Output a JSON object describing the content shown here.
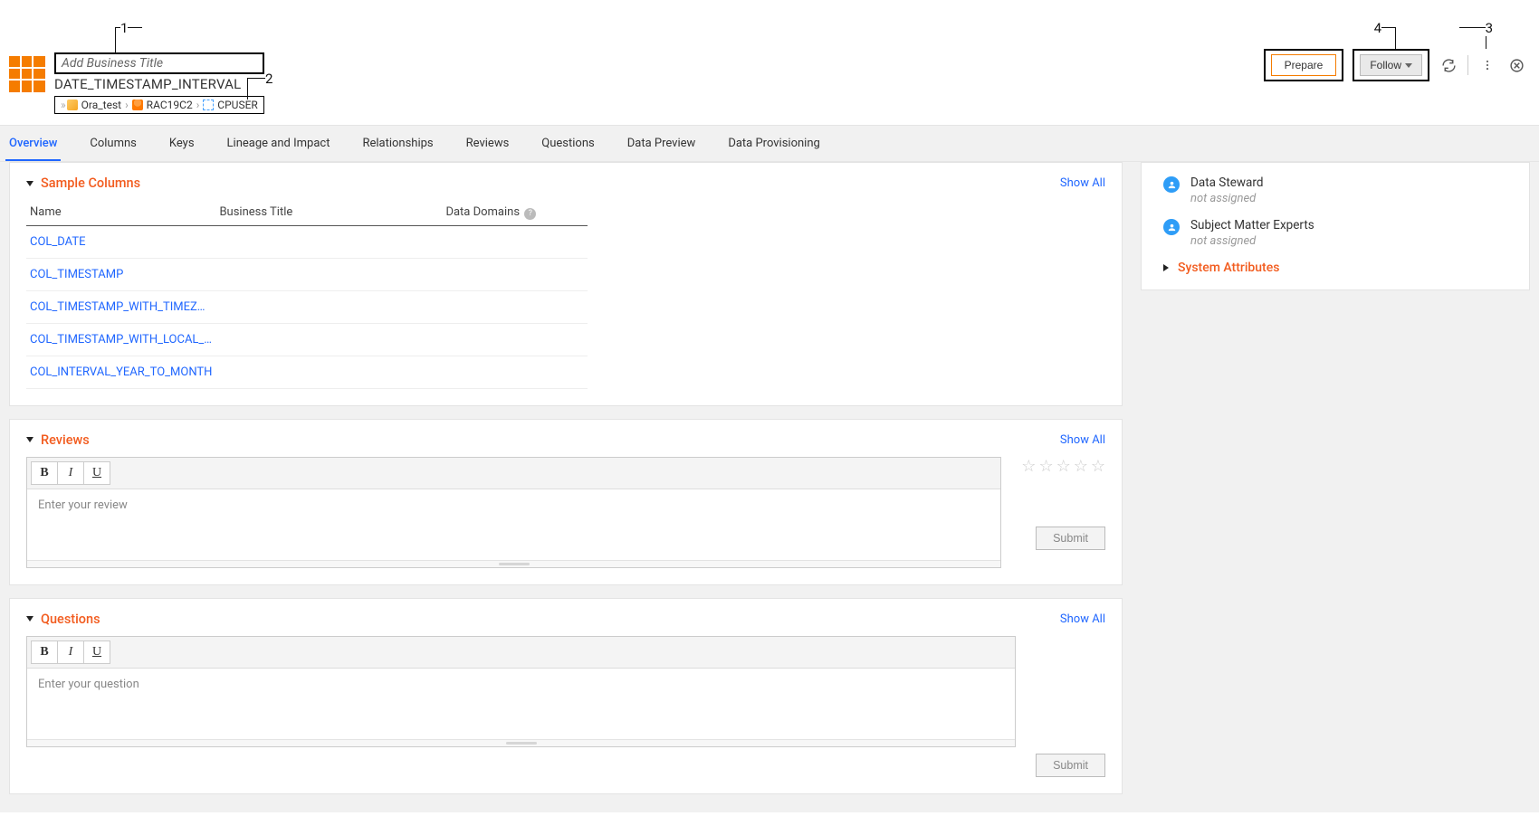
{
  "callouts": {
    "c1": "1",
    "c2": "2",
    "c3": "3",
    "c4": "4"
  },
  "header": {
    "business_title_placeholder": "Add Business Title",
    "asset_name": "DATE_TIMESTAMP_INTERVAL",
    "crumb1": "Ora_test",
    "crumb2": "RAC19C2",
    "crumb3": "CPUSER",
    "prepare_label": "Prepare",
    "follow_label": "Follow"
  },
  "tabs": [
    {
      "label": "Overview"
    },
    {
      "label": "Columns"
    },
    {
      "label": "Keys"
    },
    {
      "label": "Lineage and Impact"
    },
    {
      "label": "Relationships"
    },
    {
      "label": "Reviews"
    },
    {
      "label": "Questions"
    },
    {
      "label": "Data Preview"
    },
    {
      "label": "Data Provisioning"
    }
  ],
  "sampleColumns": {
    "title": "Sample Columns",
    "show_all": "Show All",
    "headers": {
      "name": "Name",
      "business": "Business Title",
      "domains": "Data Domains"
    },
    "rows": [
      {
        "name": "COL_DATE"
      },
      {
        "name": "COL_TIMESTAMP"
      },
      {
        "name": "COL_TIMESTAMP_WITH_TIMEZ…"
      },
      {
        "name": "COL_TIMESTAMP_WITH_LOCAL_…"
      },
      {
        "name": "COL_INTERVAL_YEAR_TO_MONTH"
      }
    ]
  },
  "reviews": {
    "title": "Reviews",
    "show_all": "Show All",
    "placeholder": "Enter your review",
    "submit": "Submit",
    "fmt": {
      "b": "B",
      "i": "I",
      "u": "U"
    }
  },
  "questions": {
    "title": "Questions",
    "show_all": "Show All",
    "placeholder": "Enter your question",
    "submit": "Submit",
    "fmt": {
      "b": "B",
      "i": "I",
      "u": "U"
    }
  },
  "rightPanel": {
    "role1": {
      "label": "Data Steward",
      "value": "not assigned"
    },
    "role2": {
      "label": "Subject Matter Experts",
      "value": "not assigned"
    },
    "sys_attr": "System Attributes"
  },
  "help_glyph": "?"
}
